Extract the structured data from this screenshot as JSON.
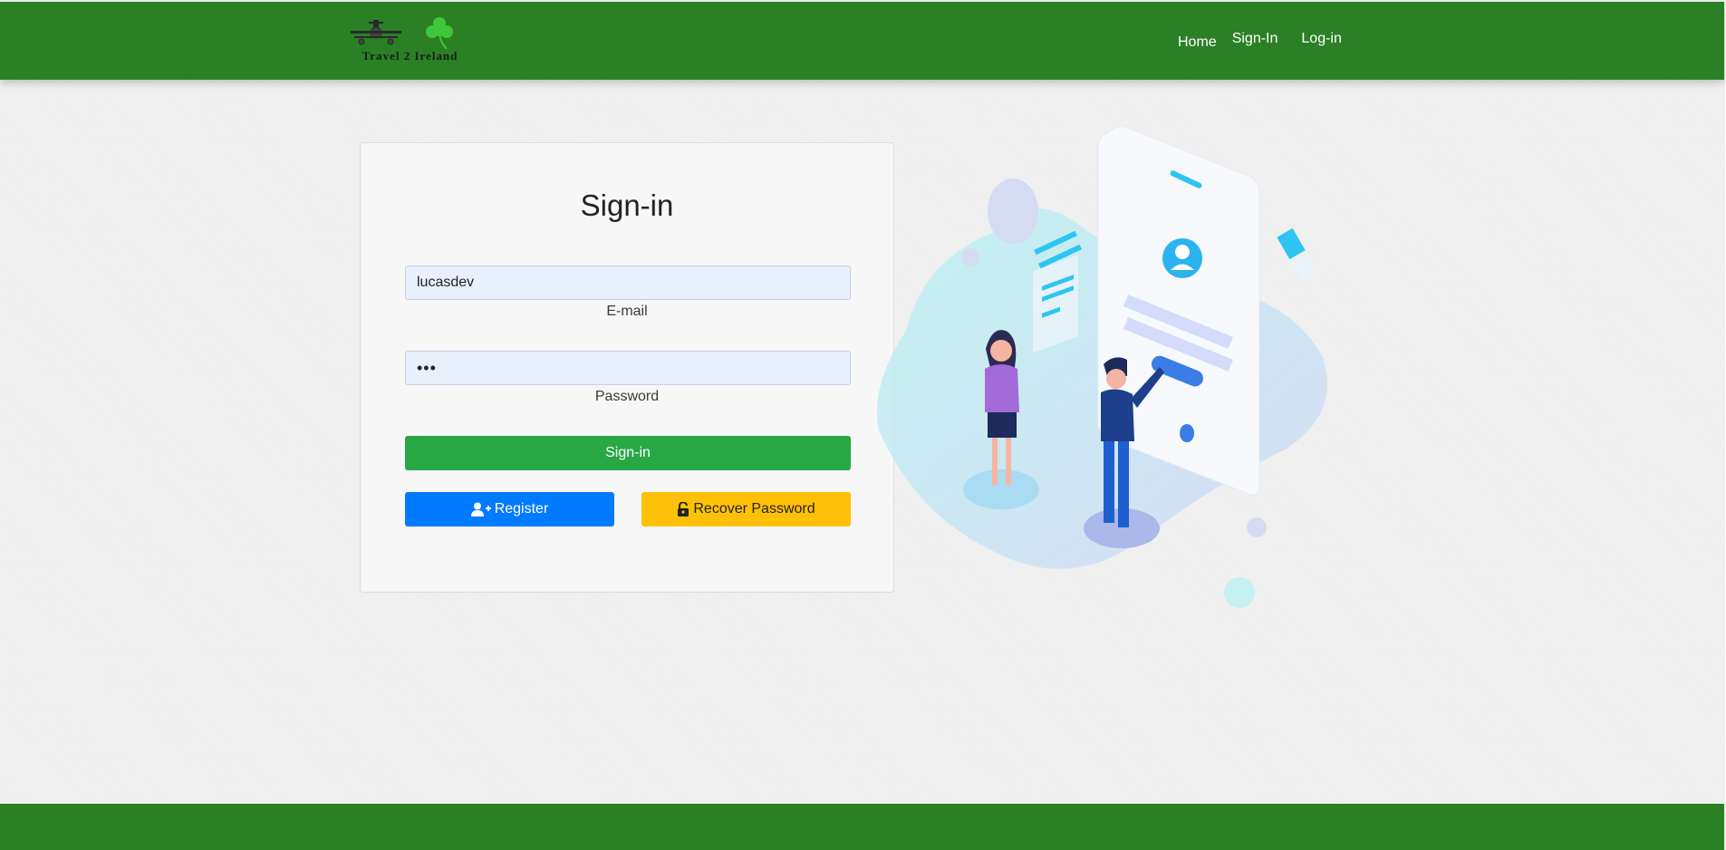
{
  "brand": {
    "name": "Travel 2 Ireland"
  },
  "nav": {
    "items": [
      {
        "label": "Home"
      },
      {
        "label": "Sign-In"
      },
      {
        "label": "Log-in"
      }
    ]
  },
  "signin_form": {
    "title": "Sign-in",
    "email": {
      "value": "lucasdev",
      "label": "E-mail"
    },
    "password": {
      "value": "•••",
      "label": "Password"
    },
    "submit_label": "Sign-in",
    "register_label": "Register",
    "recover_label": "Recover Password"
  },
  "icons": {
    "register": "user-plus-icon",
    "recover": "unlock-icon"
  },
  "colors": {
    "header": "#2b8025",
    "footer": "#2b8025",
    "signin_button": "#28a745",
    "register_button": "#007bff",
    "recover_button": "#ffc107",
    "input_background": "#e8f0fe"
  }
}
